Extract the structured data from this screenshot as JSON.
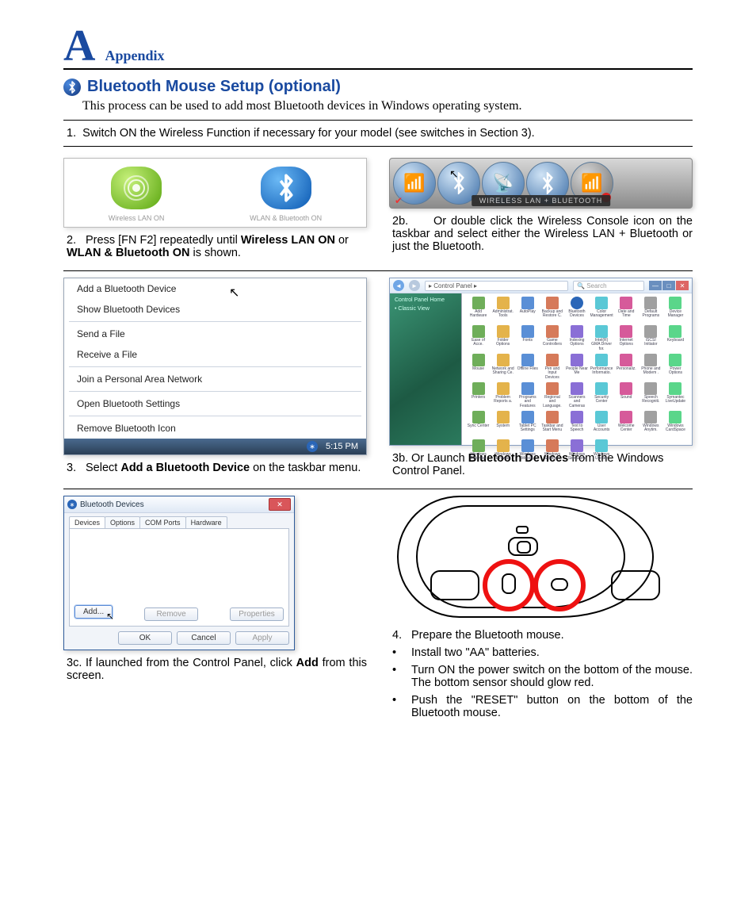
{
  "header": {
    "letter": "A",
    "appendix": "Appendix"
  },
  "title": "Bluetooth Mouse Setup (optional)",
  "intro": "This process can be used to add most Bluetooth devices in Windows operating system.",
  "step1": {
    "num": "1.",
    "text": "Switch ON the Wireless Function if necessary for your model (see switches in Section 3)."
  },
  "wireless_icons": {
    "left_label": "Wireless LAN ON",
    "right_label": "WLAN & Bluetooth ON"
  },
  "step2": {
    "num": "2.",
    "pre": "Press [FN F2] repeatedly until ",
    "b1": "Wireless LAN ON",
    "mid": " or ",
    "b2": "WLAN & Bluetooth ON",
    "post": " is shown."
  },
  "toolbar_label": "WIRELESS LAN + BLUETOOTH",
  "step2b": {
    "num": "2b.",
    "text": "Or double click the Wireless Console icon on the taskbar and select either the Wireless LAN + Bluetooth or just the Bluetooth."
  },
  "bt_menu": {
    "items": [
      "Add a Bluetooth Device",
      "Show Bluetooth Devices",
      "Send a File",
      "Receive a File",
      "Join a Personal Area Network",
      "Open Bluetooth Settings",
      "Remove Bluetooth Icon"
    ],
    "clock": "5:15 PM"
  },
  "step3": {
    "num": "3.",
    "pre": "Select ",
    "b": "Add a Bluetooth Device",
    "post": " on the taskbar menu."
  },
  "cp": {
    "address": "Control Panel",
    "search": "Search",
    "side1": "Control Panel Home",
    "side2": "Classic View",
    "items": [
      "Add Hardware",
      "Administrat. Tools",
      "AutoPlay",
      "Backup and Restore C.",
      "Bluetooth Devices",
      "Color Management",
      "Date and Time",
      "Default Programs",
      "Device Manager",
      "Ease of Acce.",
      "Folder Options",
      "Fonts",
      "Game Controllers",
      "Indexing Options",
      "Intel(R) GMA Driver for.",
      "Internet Options",
      "iSCSI Initiator",
      "Keyboard",
      "Mouse",
      "Network and Sharing Ce.",
      "Offline Files",
      "Pen and Input Devices",
      "People Near Me",
      "Performance Informatio.",
      "Personaliz.",
      "Phone and Modem .",
      "Power Options",
      "Printers",
      "Problem Reports a.",
      "Programs and Features",
      "Regional and Language.",
      "Scanners and Cameras",
      "Security Center",
      "Sound",
      "Speech Recogniti.",
      "Symantec LiveUpdate",
      "Sync Center",
      "System",
      "Tablet PC Settings",
      "Taskbar and Start Menu",
      "Text to Speech",
      "User Accounts",
      "Welcome Center",
      "Windows Anytim.",
      "Windows CardSpace",
      "Windows Defender",
      "Windows Firewall",
      "Windows Mobilit.",
      "Windows Sidebar .",
      "Windows SideShow",
      "Windows Update"
    ]
  },
  "step3b": {
    "num": "3b.",
    "pre": "Or Launch ",
    "b": "Bluetooth Devices",
    "post": " from the Windows Control Panel."
  },
  "dlg": {
    "title": "Bluetooth Devices",
    "tabs": [
      "Devices",
      "Options",
      "COM Ports",
      "Hardware"
    ],
    "add": "Add...",
    "remove": "Remove",
    "props": "Properties",
    "ok": "OK",
    "cancel": "Cancel",
    "apply": "Apply"
  },
  "step3c": {
    "num": "3c.",
    "pre": "If launched from the Control Panel, click ",
    "b": "Add",
    "post": " from this screen."
  },
  "step4": {
    "num": "4.",
    "head": "Prepare the Bluetooth mouse.",
    "b1": "Install two \"AA\" batteries.",
    "b2": "Turn ON the power switch on the bottom of the mouse. The bottom sensor should glow red.",
    "b3": "Push the \"RESET\" button on the bottom of the Bluetooth mouse."
  },
  "glyphs": {
    "bt": "∗",
    "wifi": "📶",
    "bullet": "•"
  }
}
